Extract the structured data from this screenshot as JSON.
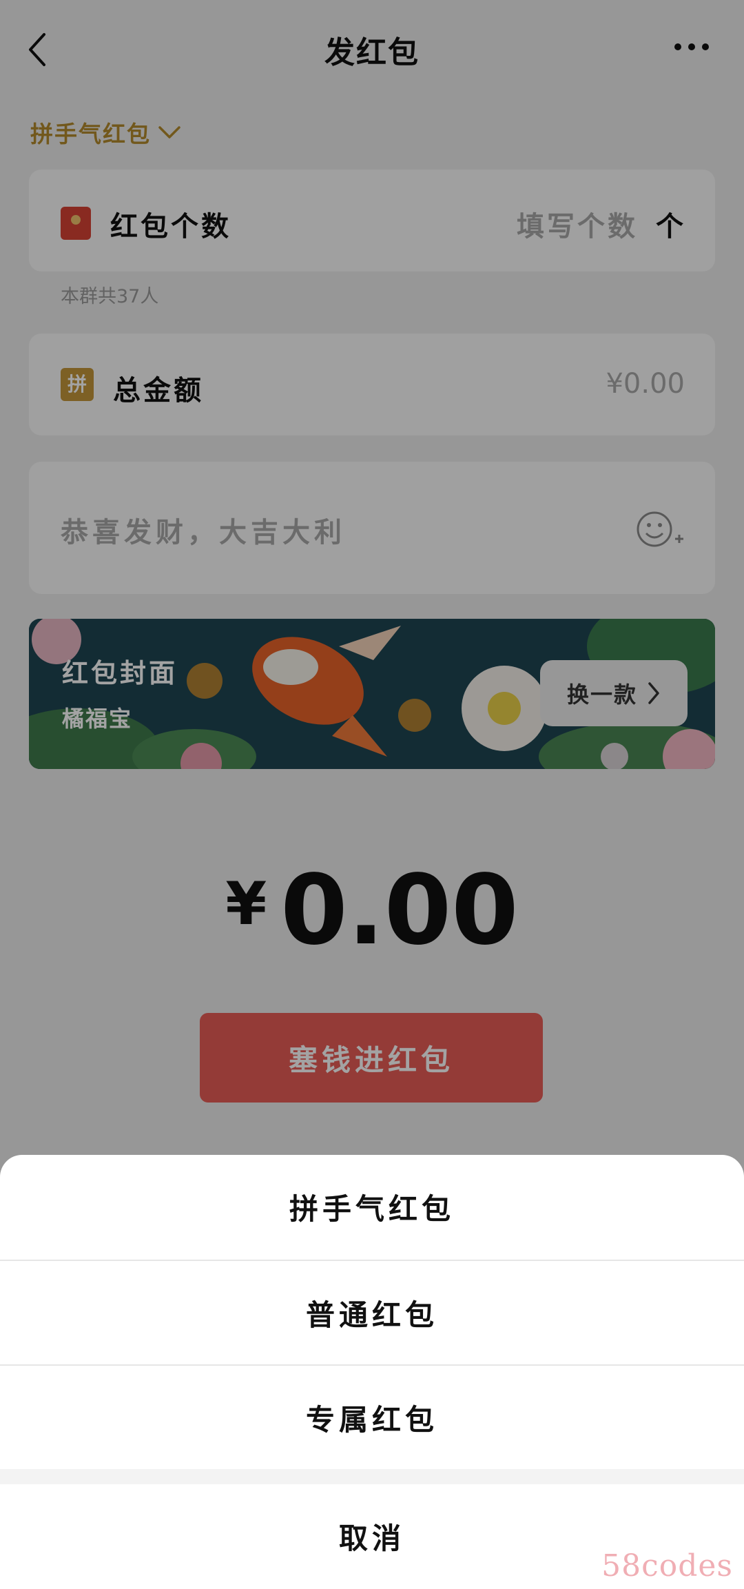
{
  "header": {
    "title": "发红包"
  },
  "type_switch": {
    "label": "拼手气红包"
  },
  "count_row": {
    "label": "红包个数",
    "placeholder": "填写个数",
    "unit": "个",
    "hint": "本群共37人"
  },
  "amount_row": {
    "badge": "拼",
    "label": "总金额",
    "value": "¥0.00"
  },
  "message_row": {
    "placeholder": "恭喜发财，大吉大利"
  },
  "cover": {
    "title": "红包封面",
    "subtitle": "橘福宝",
    "swap_label": "换一款"
  },
  "total": {
    "currency": "¥",
    "value": "0.00"
  },
  "submit": {
    "label": "塞钱进红包"
  },
  "sheet": {
    "options": [
      {
        "label": "拼手气红包"
      },
      {
        "label": "普通红包"
      },
      {
        "label": "专属红包"
      }
    ],
    "cancel": "取消"
  },
  "watermark": "58codes",
  "colors": {
    "accent_red": "#e85d57",
    "gold": "#b38a2c"
  }
}
